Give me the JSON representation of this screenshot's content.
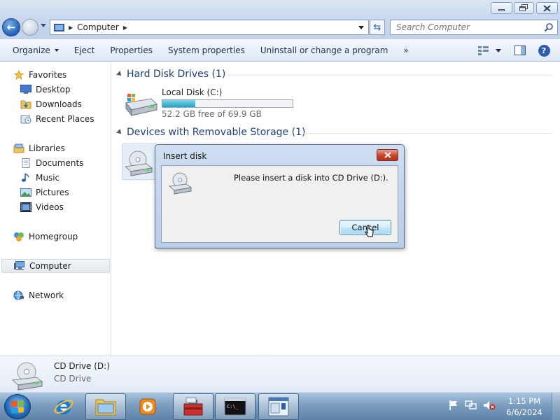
{
  "window": {
    "controls": {
      "minimize": "minimize",
      "maximize": "maximize",
      "close": "close"
    }
  },
  "address": {
    "path": "Computer",
    "search_placeholder": "Search Computer"
  },
  "toolbar": {
    "items": [
      {
        "label": "Organize",
        "has_dropdown": true
      },
      {
        "label": "Eject",
        "has_dropdown": false
      },
      {
        "label": "Properties",
        "has_dropdown": false
      },
      {
        "label": "System properties",
        "has_dropdown": false
      },
      {
        "label": "Uninstall or change a program",
        "has_dropdown": false
      }
    ],
    "overflow": "»"
  },
  "sidebar": {
    "favorites": {
      "label": "Favorites",
      "items": [
        "Desktop",
        "Downloads",
        "Recent Places"
      ]
    },
    "libraries": {
      "label": "Libraries",
      "items": [
        "Documents",
        "Music",
        "Pictures",
        "Videos"
      ]
    },
    "homegroup": "Homegroup",
    "computer": "Computer",
    "network": "Network"
  },
  "content": {
    "hard_disk_group": "Hard Disk Drives (1)",
    "local_disk": {
      "name": "Local Disk (C:)",
      "free_text": "52.2 GB free of 69.9 GB",
      "used_fraction": 0.253
    },
    "removable_group": "Devices with Removable Storage (1)"
  },
  "dialog": {
    "title": "Insert disk",
    "close_label": "x",
    "message": "Please insert a disk into CD Drive (D:).",
    "cancel_label": "Cancel"
  },
  "details": {
    "name": "CD Drive (D:)",
    "type": "CD Drive"
  },
  "taskbar": {
    "time": "1:15 PM",
    "date": "6/6/2024"
  }
}
